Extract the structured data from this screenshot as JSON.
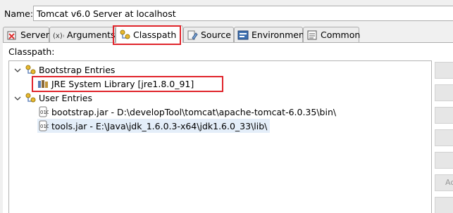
{
  "name_label": "Name:",
  "name_value": "Tomcat v6.0 Server at localhost",
  "tabs": [
    {
      "label": "Server"
    },
    {
      "label": "Arguments"
    },
    {
      "label": "Classpath"
    },
    {
      "label": "Source"
    },
    {
      "label": "Environment"
    },
    {
      "label": "Common"
    }
  ],
  "classpath_label": "Classpath:",
  "tree": {
    "bootstrap": {
      "label": "Bootstrap Entries",
      "children": [
        {
          "label": "JRE System Library [jre1.8.0_91]"
        }
      ]
    },
    "user": {
      "label": "User Entries",
      "children": [
        {
          "label": "bootstrap.jar - D:\\developTool\\tomcat\\apache-tomcat-6.0.35\\bin\\"
        },
        {
          "label": "tools.jar - E:\\Java\\jdk_1.6.0.3-x64\\jdk1.6.0_33\\lib\\"
        }
      ]
    }
  },
  "side_buttons": [
    "",
    "",
    "",
    "",
    "",
    "",
    "Ac"
  ],
  "colors": {
    "highlight": "#e0242b",
    "selection": "#e4eef9"
  }
}
